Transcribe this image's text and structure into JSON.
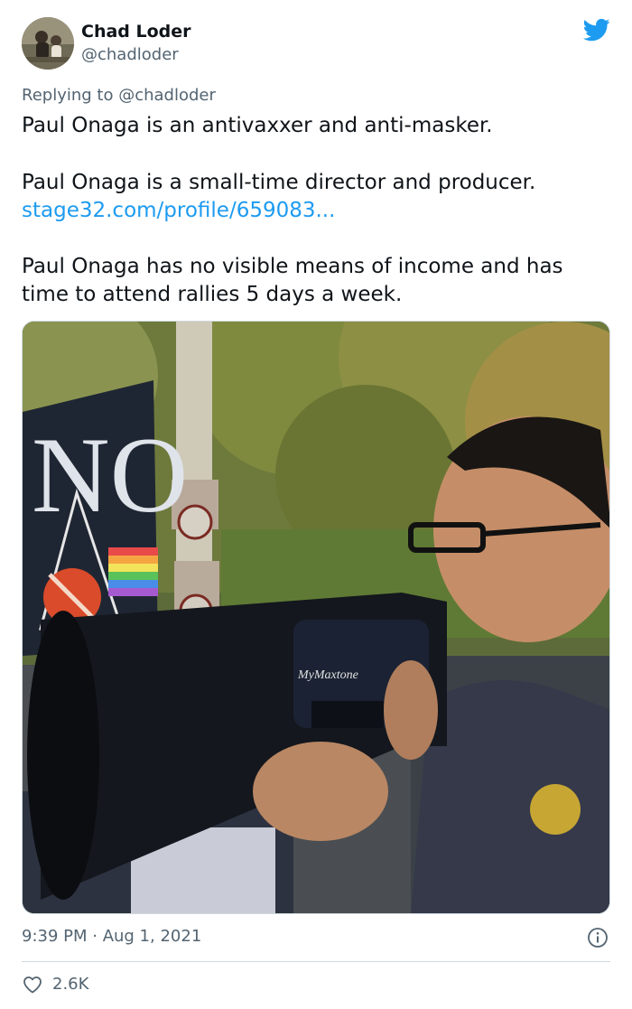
{
  "tweet": {
    "author": {
      "name": "Chad Loder",
      "handle": "@chadloder"
    },
    "reply": {
      "prefix": "Replying to",
      "handle": "@chadloder"
    },
    "body": {
      "paragraph_1": "Paul Onaga is an antivaxxer and anti-masker.",
      "paragraph_2": "Paul Onaga is a small-time director and producer.",
      "link": "stage32.com/profile/659083...",
      "paragraph_3": "Paul Onaga has no visible means of income and has time to attend rallies 5 days a week."
    },
    "media": {
      "sign_text": "NO",
      "megaphone_brand": "MyMaxtone"
    },
    "timestamp": "9:39 PM · Aug 1, 2021",
    "likes": "2.6K"
  },
  "icons": {
    "brand": "twitter-bird-icon",
    "info": "info-icon",
    "like": "heart-icon"
  },
  "colors": {
    "accent": "#1d9bf0",
    "text_primary": "#0f1419",
    "text_secondary": "#536471",
    "divider": "#cfd9de"
  }
}
